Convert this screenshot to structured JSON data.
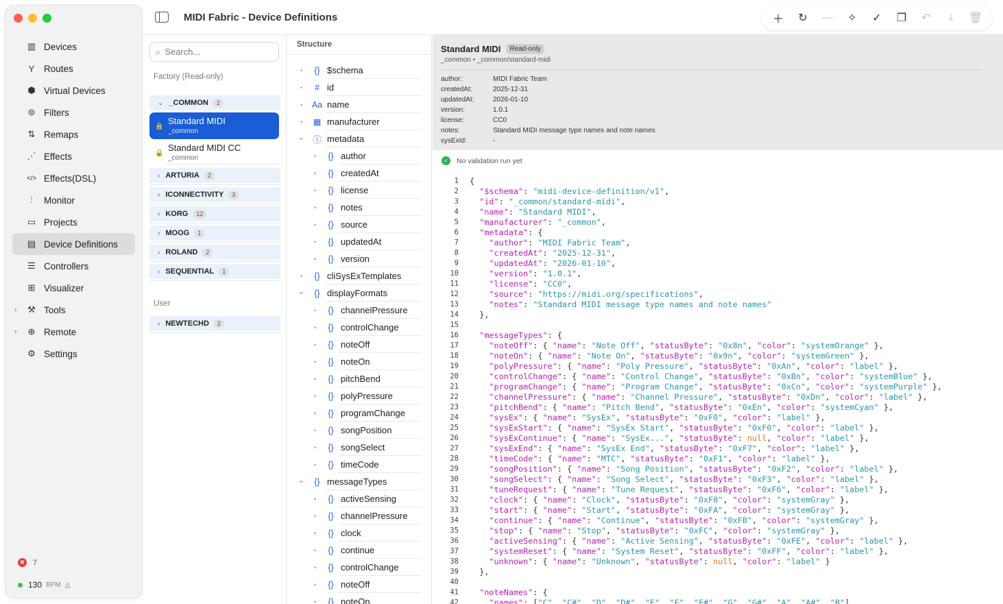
{
  "window": {
    "title": "MIDI Fabric - Device Definitions"
  },
  "colors": {
    "accent": "#1a5dd5",
    "close": "#fe5f57",
    "minimize": "#febc2e",
    "maximize": "#28c840",
    "json_key": "#b423b0",
    "json_string": "#2b95aa",
    "json_null": "#de7a14"
  },
  "sidebar": {
    "items": [
      {
        "label": "Devices",
        "icon": "grid-icon"
      },
      {
        "label": "Routes",
        "icon": "fork-icon"
      },
      {
        "label": "Virtual Devices",
        "icon": "cube-icon"
      },
      {
        "label": "Filters",
        "icon": "filter-icon"
      },
      {
        "label": "Remaps",
        "icon": "remap-icon"
      },
      {
        "label": "Effects",
        "icon": "wand-icon"
      },
      {
        "label": "Effects(DSL)",
        "icon": "code-icon"
      },
      {
        "label": "Monitor",
        "icon": "waveform-icon"
      },
      {
        "label": "Projects",
        "icon": "folder-icon"
      },
      {
        "label": "Device Definitions",
        "icon": "document-icon",
        "active": true
      },
      {
        "label": "Controllers",
        "icon": "sliders-icon"
      },
      {
        "label": "Visualizer",
        "icon": "chart-icon"
      },
      {
        "label": "Tools",
        "icon": "tools-icon",
        "expandable": true
      },
      {
        "label": "Remote",
        "icon": "globe-icon",
        "expandable": true
      },
      {
        "label": "Settings",
        "icon": "gear-icon"
      }
    ],
    "error_count": "7",
    "bpm_value": "130",
    "bpm_unit": "BPM"
  },
  "toolbar": {
    "buttons": [
      "add",
      "refresh",
      "minus",
      "magic",
      "validate",
      "copy",
      "undo",
      "download",
      "delete"
    ]
  },
  "filelist": {
    "search_placeholder": "Search...",
    "factory_label": "Factory (Read-only)",
    "user_label": "User",
    "common_group": {
      "name": "_COMMON",
      "count": "2"
    },
    "files": [
      {
        "name": "Standard MIDI",
        "sub": "_common"
      },
      {
        "name": "Standard MIDI CC",
        "sub": "_common"
      }
    ],
    "groups": [
      {
        "name": "ARTURIA",
        "count": "2"
      },
      {
        "name": "ICONNECTIVITY",
        "count": "3"
      },
      {
        "name": "KORG",
        "count": "12"
      },
      {
        "name": "MOOG",
        "count": "1"
      },
      {
        "name": "ROLAND",
        "count": "2"
      },
      {
        "name": "SEQUENTIAL",
        "count": "1"
      }
    ],
    "user_groups": [
      {
        "name": "NEWTECHD",
        "count": "2"
      }
    ]
  },
  "structure": {
    "header": "Structure",
    "rows": [
      {
        "label": "$schema",
        "icon": "{}",
        "depth": 0
      },
      {
        "label": "id",
        "icon": "#",
        "depth": 0
      },
      {
        "label": "name",
        "icon": "Aa",
        "depth": 0
      },
      {
        "label": "manufacturer",
        "icon": "▦",
        "depth": 0
      },
      {
        "label": "metadata",
        "icon": "ⓘ",
        "depth": 0,
        "expanded": true
      },
      {
        "label": "author",
        "icon": "{}",
        "depth": 1
      },
      {
        "label": "createdAt",
        "icon": "{}",
        "depth": 1
      },
      {
        "label": "license",
        "icon": "{}",
        "depth": 1
      },
      {
        "label": "notes",
        "icon": "{}",
        "depth": 1
      },
      {
        "label": "source",
        "icon": "{}",
        "depth": 1
      },
      {
        "label": "updatedAt",
        "icon": "{}",
        "depth": 1
      },
      {
        "label": "version",
        "icon": "{}",
        "depth": 1
      },
      {
        "label": "cliSysExTemplates",
        "icon": "{}",
        "depth": 0
      },
      {
        "label": "displayFormats",
        "icon": "{}",
        "depth": 0,
        "expanded": true
      },
      {
        "label": "channelPressure",
        "icon": "{}",
        "depth": 1
      },
      {
        "label": "controlChange",
        "icon": "{}",
        "depth": 1
      },
      {
        "label": "noteOff",
        "icon": "{}",
        "depth": 1
      },
      {
        "label": "noteOn",
        "icon": "{}",
        "depth": 1
      },
      {
        "label": "pitchBend",
        "icon": "{}",
        "depth": 1
      },
      {
        "label": "polyPressure",
        "icon": "{}",
        "depth": 1
      },
      {
        "label": "programChange",
        "icon": "{}",
        "depth": 1
      },
      {
        "label": "songPosition",
        "icon": "{}",
        "depth": 1
      },
      {
        "label": "songSelect",
        "icon": "{}",
        "depth": 1
      },
      {
        "label": "timeCode",
        "icon": "{}",
        "depth": 1
      },
      {
        "label": "messageTypes",
        "icon": "{}",
        "depth": 0,
        "expanded": true
      },
      {
        "label": "activeSensing",
        "icon": "{}",
        "depth": 1
      },
      {
        "label": "channelPressure",
        "icon": "{}",
        "depth": 1
      },
      {
        "label": "clock",
        "icon": "{}",
        "depth": 1
      },
      {
        "label": "continue",
        "icon": "{}",
        "depth": 1
      },
      {
        "label": "controlChange",
        "icon": "{}",
        "depth": 1
      },
      {
        "label": "noteOff",
        "icon": "{}",
        "depth": 1
      },
      {
        "label": "noteOn",
        "icon": "{}",
        "depth": 1
      }
    ]
  },
  "detail": {
    "title": "Standard MIDI",
    "readonly_badge": "Read-only",
    "path": "_common • _common/standard-midi",
    "meta": [
      {
        "k": "author:",
        "v": "MIDI Fabric Team"
      },
      {
        "k": "createdAt:",
        "v": "2025-12-31"
      },
      {
        "k": "updatedAt:",
        "v": "2026-01-10"
      },
      {
        "k": "version:",
        "v": "1.0.1"
      },
      {
        "k": "license:",
        "v": "CC0"
      },
      {
        "k": "notes:",
        "v": "Standard MIDI message type names and note names"
      },
      {
        "k": "sysExId:",
        "v": "-"
      }
    ],
    "validation": "No validation run yet",
    "code_lines": [
      "{",
      "  \"$schema\": \"midi-device-definition/v1\",",
      "  \"id\": \"_common/standard-midi\",",
      "  \"name\": \"Standard MIDI\",",
      "  \"manufacturer\": \"_common\",",
      "  \"metadata\": {",
      "    \"author\": \"MIDI Fabric Team\",",
      "    \"createdAt\": \"2025-12-31\",",
      "    \"updatedAt\": \"2026-01-10\",",
      "    \"version\": \"1.0.1\",",
      "    \"license\": \"CC0\",",
      "    \"source\": \"https://midi.org/specifications\",",
      "    \"notes\": \"Standard MIDI message type names and note names\"",
      "  },",
      "",
      "  \"messageTypes\": {",
      "    \"noteOff\": { \"name\": \"Note Off\", \"statusByte\": \"0x8n\", \"color\": \"systemOrange\" },",
      "    \"noteOn\": { \"name\": \"Note On\", \"statusByte\": \"0x9n\", \"color\": \"systemGreen\" },",
      "    \"polyPressure\": { \"name\": \"Poly Pressure\", \"statusByte\": \"0xAn\", \"color\": \"label\" },",
      "    \"controlChange\": { \"name\": \"Control Change\", \"statusByte\": \"0xBn\", \"color\": \"systemBlue\" },",
      "    \"programChange\": { \"name\": \"Program Change\", \"statusByte\": \"0xCn\", \"color\": \"systemPurple\" },",
      "    \"channelPressure\": { \"name\": \"Channel Pressure\", \"statusByte\": \"0xDn\", \"color\": \"label\" },",
      "    \"pitchBend\": { \"name\": \"Pitch Bend\", \"statusByte\": \"0xEn\", \"color\": \"systemCyan\" },",
      "    \"sysEx\": { \"name\": \"SysEx\", \"statusByte\": \"0xF0\", \"color\": \"label\" },",
      "    \"sysExStart\": { \"name\": \"SysEx Start\", \"statusByte\": \"0xF0\", \"color\": \"label\" },",
      "    \"sysExContinue\": { \"name\": \"SysEx...\", \"statusByte\": null, \"color\": \"label\" },",
      "    \"sysExEnd\": { \"name\": \"SysEx End\", \"statusByte\": \"0xF7\", \"color\": \"label\" },",
      "    \"timeCode\": { \"name\": \"MTC\", \"statusByte\": \"0xF1\", \"color\": \"label\" },",
      "    \"songPosition\": { \"name\": \"Song Position\", \"statusByte\": \"0xF2\", \"color\": \"label\" },",
      "    \"songSelect\": { \"name\": \"Song Select\", \"statusByte\": \"0xF3\", \"color\": \"label\" },",
      "    \"tuneRequest\": { \"name\": \"Tune Request\", \"statusByte\": \"0xF6\", \"color\": \"label\" },",
      "    \"clock\": { \"name\": \"Clock\", \"statusByte\": \"0xF8\", \"color\": \"systemGray\" },",
      "    \"start\": { \"name\": \"Start\", \"statusByte\": \"0xFA\", \"color\": \"systemGray\" },",
      "    \"continue\": { \"name\": \"Continue\", \"statusByte\": \"0xFB\", \"color\": \"systemGray\" },",
      "    \"stop\": { \"name\": \"Stop\", \"statusByte\": \"0xFC\", \"color\": \"systemGray\" },",
      "    \"activeSensing\": { \"name\": \"Active Sensing\", \"statusByte\": \"0xFE\", \"color\": \"label\" },",
      "    \"systemReset\": { \"name\": \"System Reset\", \"statusByte\": \"0xFF\", \"color\": \"label\" },",
      "    \"unknown\": { \"name\": \"Unknown\", \"statusByte\": null, \"color\": \"label\" }",
      "  },",
      "",
      "  \"noteNames\": {",
      "    \"names\": [\"C\", \"C#\", \"D\", \"D#\", \"E\", \"F\", \"F#\", \"G\", \"G#\", \"A\", \"A#\", \"B\"]"
    ]
  }
}
